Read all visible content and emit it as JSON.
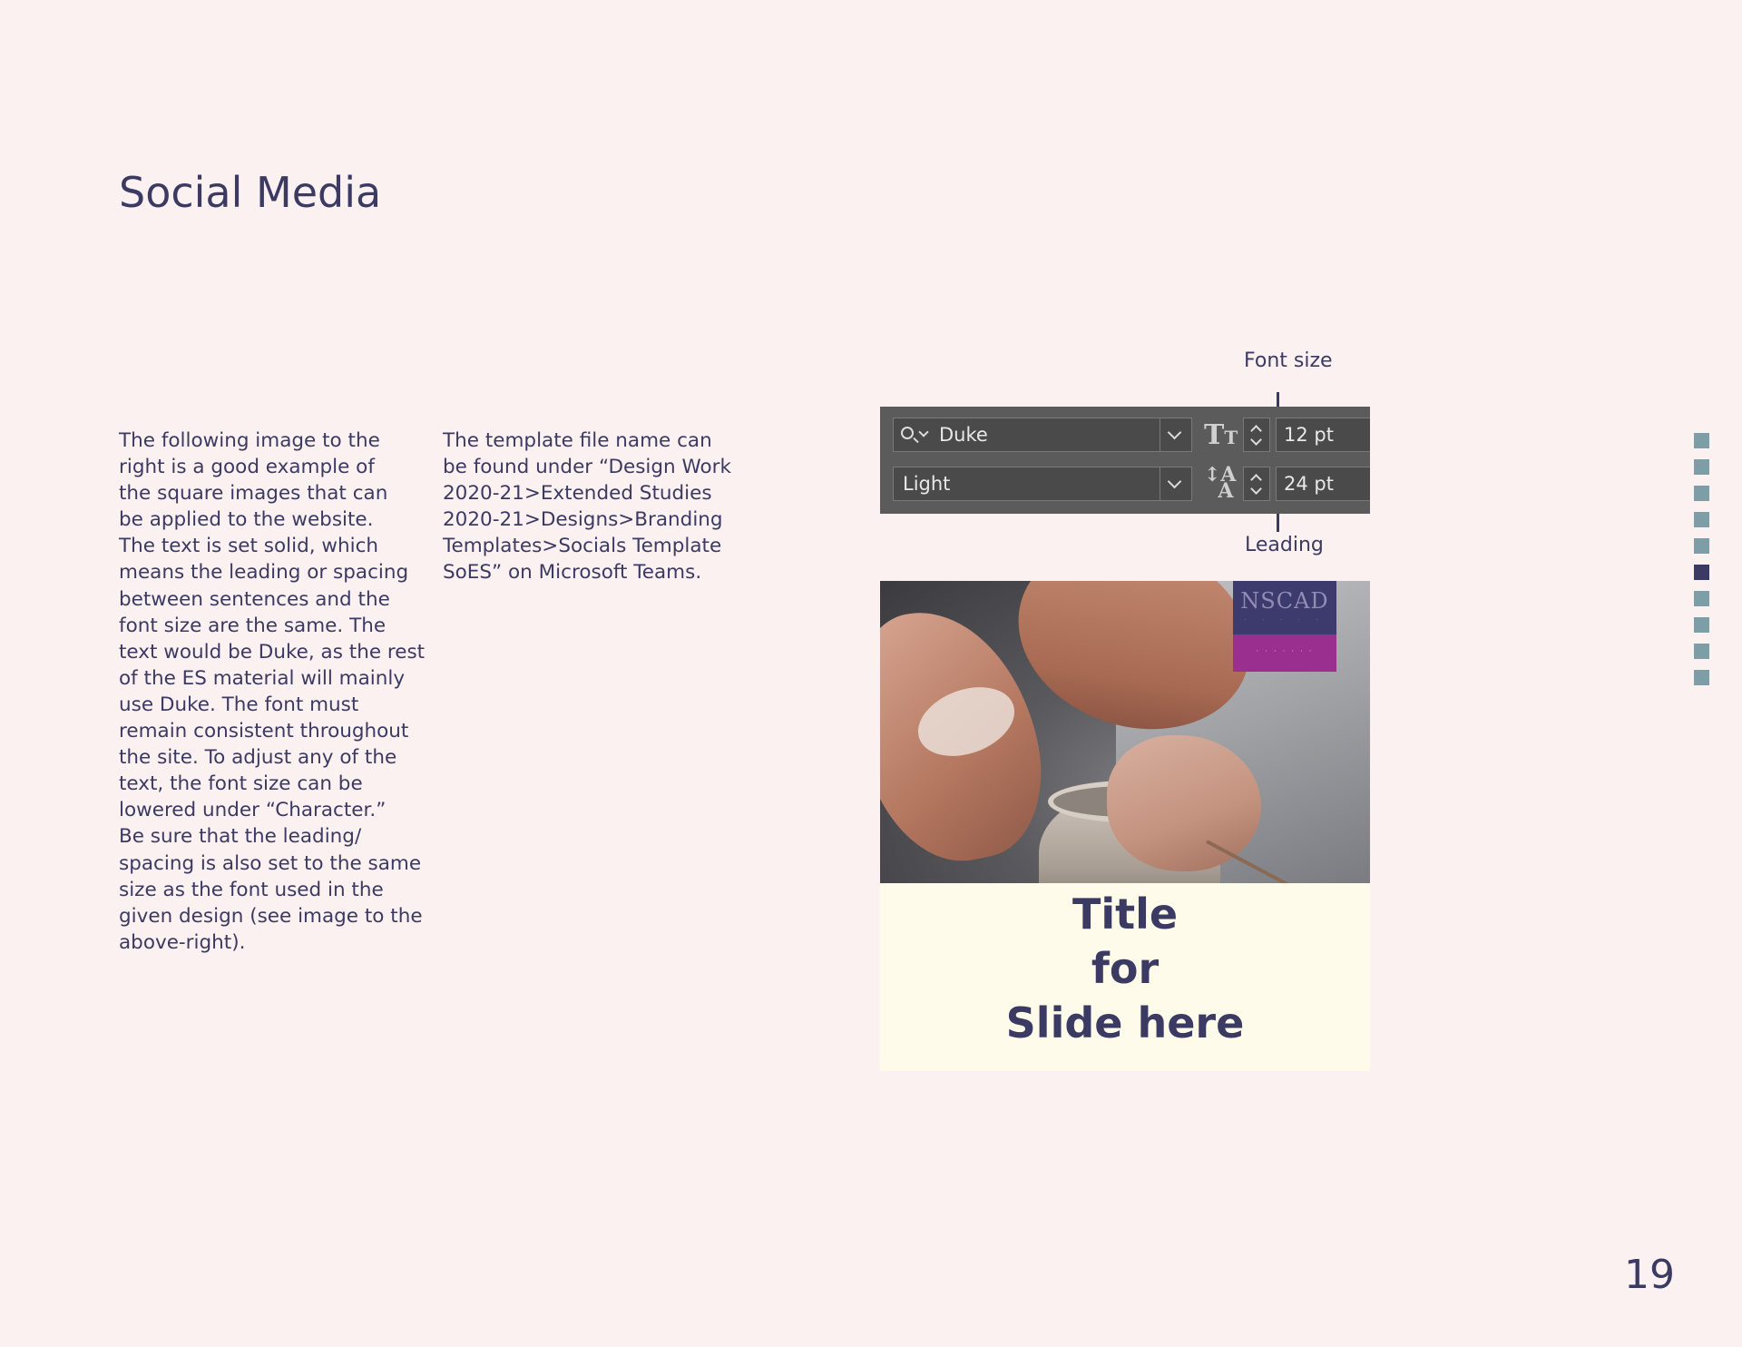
{
  "page": {
    "title": "Social Media",
    "page_number": "19"
  },
  "column_1": {
    "lines": [
      "The following image to the",
      "right is a good example of",
      "the square images that can",
      "be applied to the website.",
      "The text is set solid, which",
      "means the leading or spacing",
      "between sentences and the",
      "font size are the same. The",
      "text would be Duke, as the rest",
      "of the ES material will mainly",
      "use Duke. The font must",
      "remain consistent throughout",
      "the site. To adjust any of the",
      "text, the font size can be",
      "lowered under “Character.”",
      "Be sure that the leading/",
      "spacing is also set to the same",
      "size as the font used in the",
      "given design (see image to the",
      "above-right)."
    ]
  },
  "column_2": {
    "lines": [
      "The template file name can",
      "be found under “Design Work",
      "2020-21>Extended Studies",
      "2020-21>Designs>Branding",
      "Templates>Socials Template",
      "SoES” on Microsoft Teams."
    ]
  },
  "character_panel": {
    "font_size_callout": "Font size",
    "leading_callout": "Leading",
    "font_family": "Duke",
    "font_style": "Light",
    "font_size": "12 pt",
    "leading": "24 pt",
    "colors": {
      "panel": "#5b5b5b",
      "field": "#4a4a4a"
    }
  },
  "social_post": {
    "logo_text": "NSCAD",
    "title_lines": [
      "Title",
      "for",
      "Slide here"
    ],
    "colors": {
      "logo_block": "#3d3b6e",
      "accent_block": "#9b2f8f",
      "caption_bg": "#fefbea"
    }
  },
  "side_nav": {
    "count": 10,
    "active_index": 5,
    "colors": {
      "inactive": "#7d9ea6",
      "active": "#3b3a63"
    }
  },
  "theme": {
    "background": "#fcf1f1",
    "text": "#3b3a63"
  }
}
